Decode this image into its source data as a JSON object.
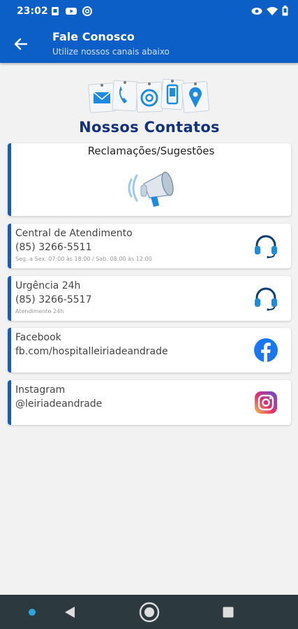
{
  "status_bar": {
    "time": "23:02",
    "left_icons": [
      "sim-icon",
      "youtube-icon",
      "at-icon"
    ],
    "right_icons": [
      "eye-icon",
      "wifi-icon",
      "battery-icon"
    ]
  },
  "app_bar": {
    "title": "Fale Conosco",
    "subtitle": "Utilize nossos canais abaixo",
    "back_icon": "arrow-back-icon",
    "color": "#0d5fc8"
  },
  "header": {
    "title": "Nossos Contatos",
    "icons": [
      "envelope-icon",
      "phone-icon",
      "at-icon",
      "mobile-icon",
      "location-pin-icon"
    ]
  },
  "feedback": {
    "label": "Reclamações/Sugestões",
    "icon": "megaphone-icon"
  },
  "contacts": [
    {
      "label": "Central de Atendimento",
      "value": "(85) 3266-5511",
      "note": "Seg. a Sex. 07:00 às 18:00 / Sab. 08:00 às 12:00",
      "icon": "headset-icon"
    },
    {
      "label": "Urgência 24h",
      "value": "(85) 3266-5517",
      "note": "Atendimento 24h",
      "icon": "headset-icon"
    },
    {
      "label": "Facebook",
      "value": "fb.com/hospitalleiriadeandrade",
      "icon": "facebook-icon"
    },
    {
      "label": "Instagram",
      "value": "@leiriadeandrade",
      "icon": "instagram-icon"
    }
  ],
  "nav_bar": {
    "items": [
      "keyboard-dot-icon",
      "back-triangle-icon",
      "home-circle-icon",
      "recents-square-icon"
    ]
  }
}
